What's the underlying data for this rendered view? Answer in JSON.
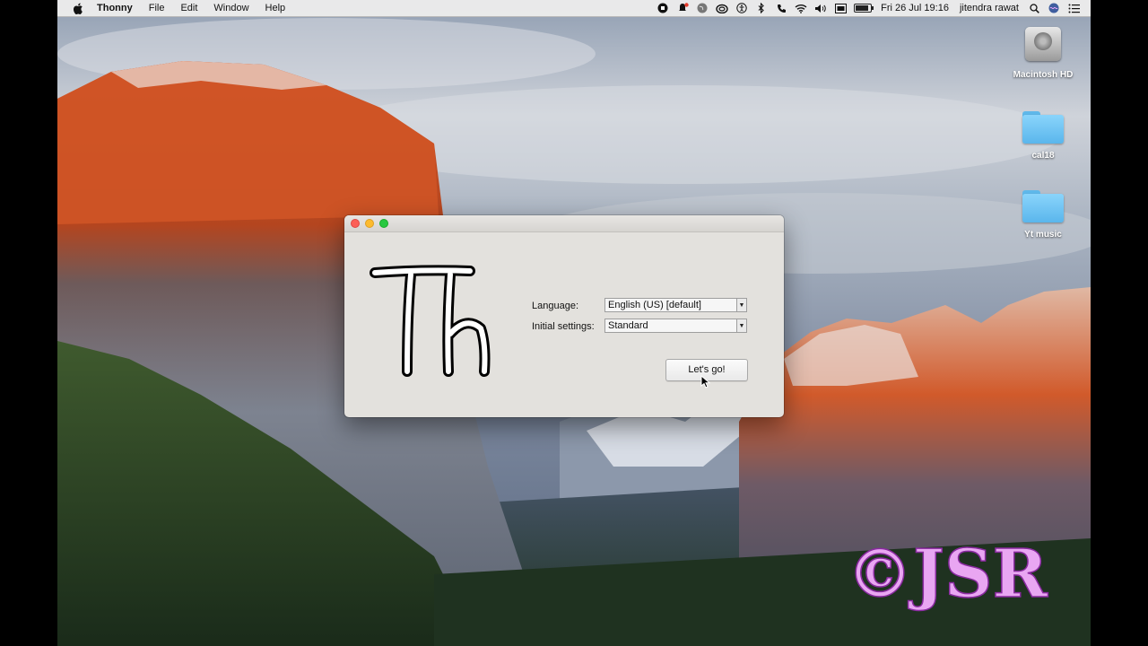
{
  "menubar": {
    "apple_icon": "apple-logo-icon",
    "app_name": "Thonny",
    "items": [
      "File",
      "Edit",
      "Window",
      "Help"
    ],
    "tray_icons": [
      "screen-record-icon",
      "notification-bell-icon",
      "globe-icon",
      "cloud-icon",
      "accessibility-icon",
      "bluetooth-icon",
      "phone-icon",
      "wifi-icon",
      "volume-icon",
      "flag-icon",
      "battery-icon"
    ],
    "datetime": "Fri 26 Jul  19:16",
    "user": "jitendra rawat",
    "right_icons": [
      "spotlight-search-icon",
      "siri-icon",
      "notification-center-icon"
    ]
  },
  "desktop": {
    "icons": [
      {
        "label": "Macintosh HD",
        "kind": "hard-drive-icon"
      },
      {
        "label": "cal18",
        "kind": "folder-icon"
      },
      {
        "label": "Yt music",
        "kind": "folder-icon"
      }
    ]
  },
  "dialog": {
    "logo_text": "Th",
    "language_label": "Language:",
    "language_value": "English (US) [default]",
    "settings_label": "Initial settings:",
    "settings_value": "Standard",
    "go_button": "Let's go!"
  },
  "watermark": {
    "text": "©JSR",
    "color": "#e9a6f2"
  },
  "colors": {
    "close": "#fc5f57",
    "minimize": "#fdbb2e",
    "maximize": "#28c840",
    "folder": "#6cc4f4"
  }
}
